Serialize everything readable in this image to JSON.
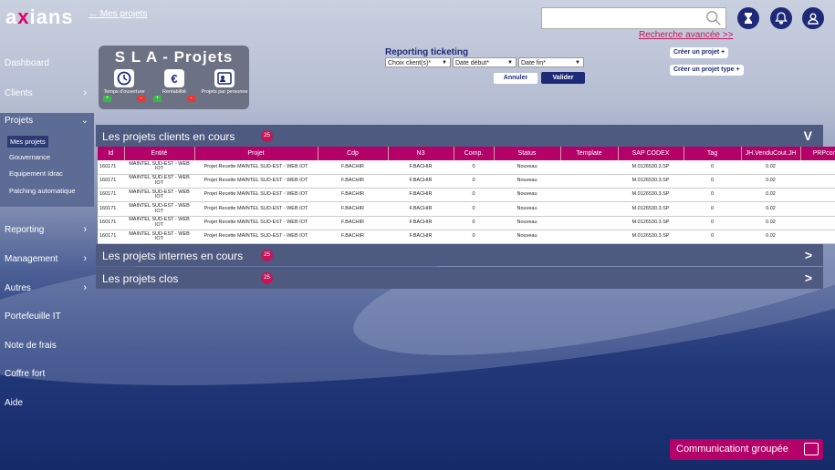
{
  "brand": {
    "logo_a": "a",
    "logo_x": "x",
    "logo_rest": "ians"
  },
  "breadcrumb": "← Mes projets",
  "search": {
    "placeholder": "",
    "advanced_link": "Recherche avancée >>"
  },
  "sidebar": {
    "items": [
      {
        "label": "Dashboard",
        "chevron": ""
      },
      {
        "label": "Clients",
        "chevron": "›"
      },
      {
        "label": "Projets",
        "chevron": "⌄"
      },
      {
        "label": "Reporting",
        "chevron": "›"
      },
      {
        "label": "Management",
        "chevron": "›"
      },
      {
        "label": "Autres",
        "chevron": "›"
      },
      {
        "label": "Portefeuille IT",
        "chevron": ""
      },
      {
        "label": "Note de frais",
        "chevron": ""
      },
      {
        "label": "Coffre fort",
        "chevron": ""
      },
      {
        "label": "Aide",
        "chevron": ""
      }
    ],
    "projets_sub": [
      "Mes projets",
      "Gouvernance",
      "Equipement Idrac",
      "Patching automatique"
    ]
  },
  "sla": {
    "title": "S L A - Projets",
    "kpis": [
      {
        "label": "Temps d'ouverture",
        "icon": "clock-icon"
      },
      {
        "label": "Rentabilité",
        "icon": "euro-icon"
      },
      {
        "label": "Projets par personne",
        "icon": "person-card-icon"
      }
    ],
    "plus": "+",
    "minus": "-"
  },
  "reporting": {
    "title": "Reporting ticketing",
    "client_select": "Choix client(s)*",
    "date_debut": "Date début*",
    "date_fin": "Date fin*",
    "annuler": "Annuler",
    "valider": "Valider"
  },
  "create": {
    "projet": "Créer un projet",
    "projet_type": "Créer un projet type"
  },
  "panels": {
    "clients": {
      "title": "Les projets clients en cours",
      "count": "25",
      "chevron": "V"
    },
    "internes": {
      "title": "Les projets internes en cours",
      "count": "25",
      "chevron": ">"
    },
    "clos": {
      "title": "Les projets clos",
      "count": "25",
      "chevron": ">"
    }
  },
  "table": {
    "headers": [
      "Id",
      "Entité",
      "Projet",
      "Cdp",
      "N3",
      "Comp.",
      "Status",
      "Template",
      "SAP CODEX",
      "Tag",
      "JH.VenduCout.JH",
      "PRPcom"
    ],
    "rows": [
      [
        "160171",
        "MAINTEL SUD-EST - WEB IOT",
        "Projet Recette MAINTEL SUD-EST - WEB IOT",
        "F.BACHIR",
        "F.BACHIR",
        "0",
        "Nouveau",
        "",
        "M.0126530.3.SP",
        "0",
        "0.02",
        ""
      ],
      [
        "160171",
        "MAINTEL SUD-EST - WEB IOT",
        "Projet Recette MAINTEL SUD-EST - WEB IOT",
        "F.BACHIR",
        "F.BACHIR",
        "0",
        "Nouveau",
        "",
        "M.0126530.3.SP",
        "0",
        "0.02",
        ""
      ],
      [
        "160171",
        "MAINTEL SUD-EST - WEB IOT",
        "Projet Recette MAINTEL SUD-EST - WEB IOT",
        "F.BACHIR",
        "F.BACHIR",
        "0",
        "Nouveau",
        "",
        "M.0126530.3.SP",
        "0",
        "0.02",
        ""
      ],
      [
        "160171",
        "MAINTEL SUD-EST - WEB IOT",
        "Projet Recette MAINTEL SUD-EST - WEB IOT",
        "F.BACHIR",
        "F.BACHIR",
        "0",
        "Nouveau",
        "",
        "M.0126530.3.SP",
        "0",
        "0.02",
        ""
      ],
      [
        "160171",
        "MAINTEL SUD-EST - WEB IOT",
        "Projet Recette MAINTEL SUD-EST - WEB IOT",
        "F.BACHIR",
        "F.BACHIR",
        "0",
        "Nouveau",
        "",
        "M.0126530.3.SP",
        "0",
        "0.02",
        ""
      ],
      [
        "160171",
        "MAINTEL SUD-EST - WEB IOT",
        "Projet Recette MAINTEL SUD-EST - WEB IOT",
        "F.BACHIR",
        "F.BACHIR",
        "0",
        "Nouveau",
        "",
        "M.0126530.3.SP",
        "0",
        "0.02",
        ""
      ]
    ]
  },
  "communication": "Communicationt groupée",
  "colors": {
    "accent": "#b5006a",
    "navy": "#1e2a78",
    "panel": "#4e5a7f"
  }
}
